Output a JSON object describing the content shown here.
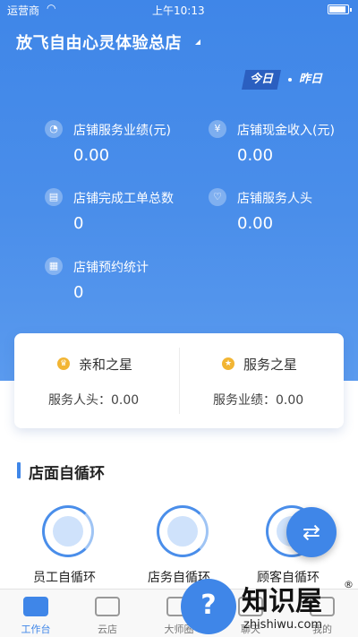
{
  "status_bar": {
    "carrier": "运营商",
    "time": "上午10:13"
  },
  "header": {
    "store_name": "放飞自由心灵体验总店"
  },
  "day_toggle": {
    "today": "今日",
    "yesterday": "昨日"
  },
  "stats": [
    {
      "label": "店铺服务业绩(元)",
      "value": "0.00",
      "icon": "pie-chart-icon",
      "glyph": "◔"
    },
    {
      "label": "店铺现金收入(元)",
      "value": "0.00",
      "icon": "yen-icon",
      "glyph": "¥"
    },
    {
      "label": "店铺完成工单总数",
      "value": "0",
      "icon": "clipboard-icon",
      "glyph": "▤"
    },
    {
      "label": "店铺服务人头",
      "value": "0.00",
      "icon": "heart-icon",
      "glyph": "♡"
    },
    {
      "label": "店铺预约统计",
      "value": "0",
      "icon": "calendar-icon",
      "glyph": "▦"
    }
  ],
  "stars": [
    {
      "title": "亲和之星",
      "line": "服务人头：0.00",
      "icon": "trophy-icon",
      "glyph": "♛"
    },
    {
      "title": "服务之星",
      "line": "服务业绩：0.00",
      "icon": "medal-icon",
      "glyph": "★"
    }
  ],
  "section": {
    "title": "店面自循环"
  },
  "loops": [
    {
      "label": "员工自循环",
      "icon": "employee-loop-icon"
    },
    {
      "label": "店务自循环",
      "icon": "store-loop-icon"
    },
    {
      "label": "顾客自循环",
      "icon": "customer-loop-icon"
    }
  ],
  "tabbar": [
    {
      "label": "工作台",
      "active": true,
      "icon": "workbench-icon"
    },
    {
      "label": "云店",
      "active": false,
      "icon": "cloud-store-icon"
    },
    {
      "label": "大师圈",
      "active": false,
      "icon": "master-circle-icon"
    },
    {
      "label": "聊天",
      "active": false,
      "icon": "chat-icon"
    },
    {
      "label": "我的",
      "active": false,
      "icon": "profile-icon"
    }
  ],
  "watermark": {
    "name": "知识屋",
    "url": "zhishiwu.com",
    "reg": "®",
    "glyph": "?"
  },
  "colors": {
    "primary": "#3f86e8",
    "gold": "#f2b533"
  }
}
